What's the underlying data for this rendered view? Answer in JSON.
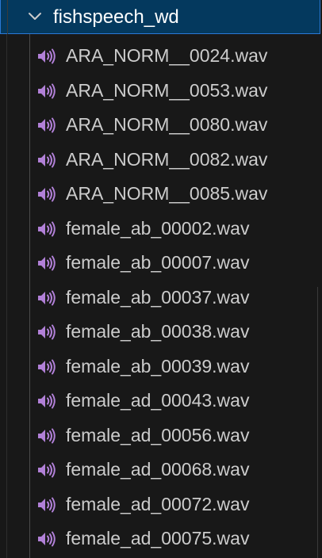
{
  "explorer": {
    "folder": {
      "name": "fishspeech_wd",
      "expanded": true,
      "chevron_icon": "chevron-down-icon"
    },
    "file_icon": "audio-file-icon",
    "icon_color": "#b180d7",
    "accent_color": "#2b79d6",
    "selection_background": "#04395e",
    "files": [
      {
        "name": "ARA_NORM__0024.wav"
      },
      {
        "name": "ARA_NORM__0053.wav"
      },
      {
        "name": "ARA_NORM__0080.wav"
      },
      {
        "name": "ARA_NORM__0082.wav"
      },
      {
        "name": "ARA_NORM__0085.wav"
      },
      {
        "name": "female_ab_00002.wav"
      },
      {
        "name": "female_ab_00007.wav"
      },
      {
        "name": "female_ab_00037.wav"
      },
      {
        "name": "female_ab_00038.wav"
      },
      {
        "name": "female_ab_00039.wav"
      },
      {
        "name": "female_ad_00043.wav"
      },
      {
        "name": "female_ad_00056.wav"
      },
      {
        "name": "female_ad_00068.wav"
      },
      {
        "name": "female_ad_00072.wav"
      },
      {
        "name": "female_ad_00075.wav"
      }
    ]
  }
}
